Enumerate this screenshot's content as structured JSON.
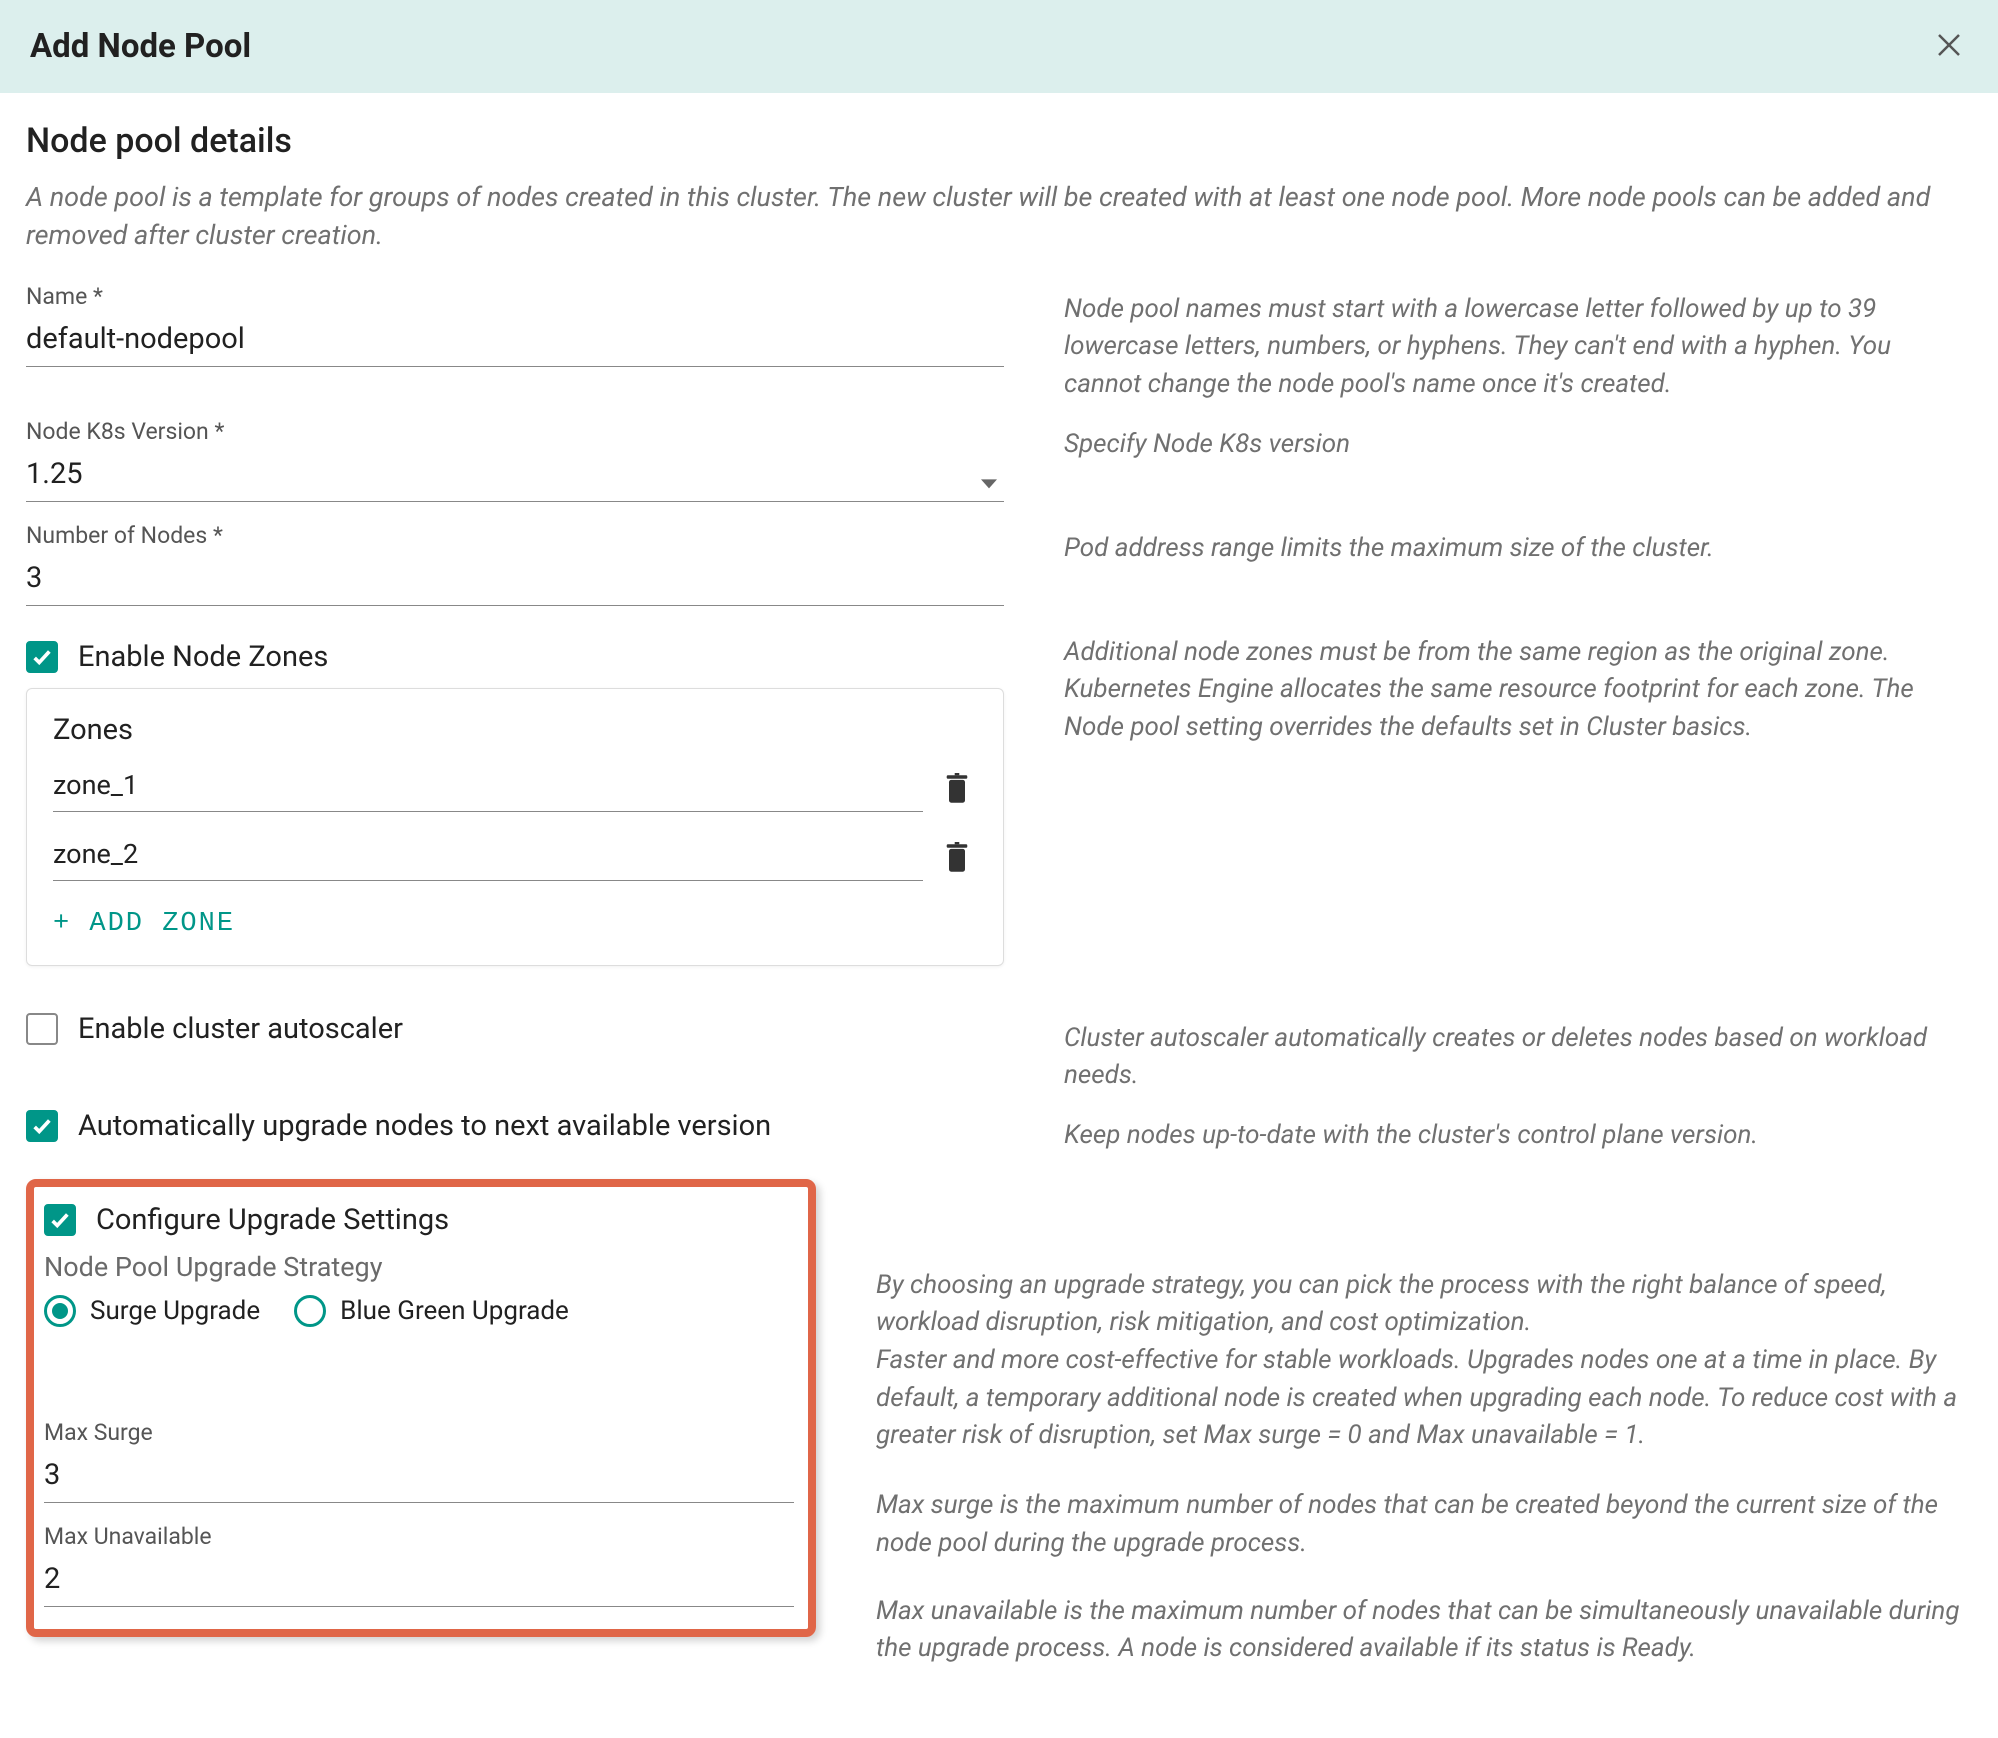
{
  "dialog": {
    "title": "Add Node Pool"
  },
  "section": {
    "title": "Node pool details",
    "desc": "A node pool is a template for groups of nodes created in this cluster. The new cluster will be created with at least one node pool. More node pools can be added and removed after cluster creation."
  },
  "fields": {
    "name": {
      "label": "Name *",
      "value": "default-nodepool",
      "help": "Node pool names must start with a lowercase letter followed by up to 39 lowercase letters, numbers, or hyphens. They can't end with a hyphen. You cannot change the node pool's name once it's created."
    },
    "k8s_version": {
      "label": "Node K8s Version *",
      "value": "1.25",
      "help": "Specify Node K8s version"
    },
    "num_nodes": {
      "label": "Number of Nodes *",
      "value": "3",
      "help": "Pod address range limits the maximum size of the cluster."
    },
    "enable_zones": {
      "label": "Enable Node Zones",
      "checked": true,
      "help": "Additional node zones must be from the same region as the original zone. Kubernetes Engine allocates the same resource footprint for each zone. The Node pool setting overrides the defaults set in Cluster basics."
    },
    "zones": {
      "title": "Zones",
      "items": [
        "zone_1",
        "zone_2"
      ],
      "add_label": "+ Add Zone"
    },
    "enable_autoscaler": {
      "label": "Enable cluster autoscaler",
      "checked": false,
      "help": "Cluster autoscaler automatically creates or deletes nodes based on workload needs."
    },
    "auto_upgrade": {
      "label": "Automatically upgrade nodes to next available version",
      "checked": true,
      "help": "Keep nodes up-to-date with the cluster's control plane version."
    },
    "configure_upgrade": {
      "label": "Configure Upgrade Settings",
      "checked": true
    },
    "upgrade_strategy": {
      "heading": "Node Pool Upgrade Strategy",
      "options": {
        "surge": "Surge Upgrade",
        "bluegreen": "Blue Green Upgrade"
      },
      "selected": "surge",
      "help1": "By choosing an upgrade strategy, you can pick the process with the right balance of speed, workload disruption, risk mitigation, and cost optimization.",
      "help2": "Faster and more cost-effective for stable workloads. Upgrades nodes one at a time in place. By default, a temporary additional node is created when upgrading each node. To reduce cost with a greater risk of disruption, set Max surge = 0 and Max unavailable = 1."
    },
    "max_surge": {
      "label": "Max Surge",
      "value": "3",
      "help": "Max surge is the maximum number of nodes that can be created beyond the current size of the node pool during the upgrade process."
    },
    "max_unavailable": {
      "label": "Max Unavailable",
      "value": "2",
      "help": "Max unavailable is the maximum number of nodes that can be simultaneously unavailable during the upgrade process. A node is considered available if its status is Ready."
    }
  }
}
